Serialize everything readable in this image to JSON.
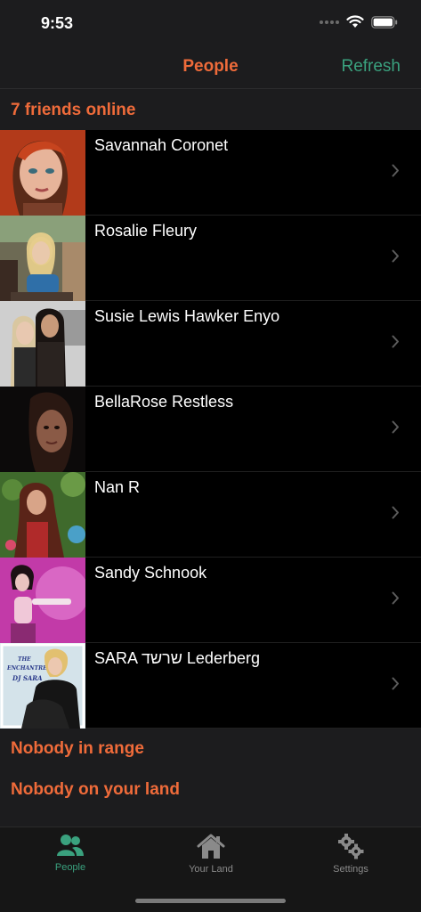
{
  "status": {
    "time": "9:53"
  },
  "nav": {
    "title": "People",
    "refresh_label": "Refresh"
  },
  "sections": {
    "online": "7 friends online",
    "in_range": "Nobody in range",
    "on_land": "Nobody on your land"
  },
  "friends": [
    {
      "name": "Savannah Coronet",
      "avatar": "red-haired-woman-avatar"
    },
    {
      "name": "Rosalie Fleury",
      "avatar": "blonde-woman-seated-avatar"
    },
    {
      "name": "Susie Lewis Hawker Enyo",
      "avatar": "couple-avatar"
    },
    {
      "name": "BellaRose Restless",
      "avatar": "dark-haired-woman-avatar"
    },
    {
      "name": "Nan R",
      "avatar": "woman-in-garden-avatar"
    },
    {
      "name": "Sandy Schnook",
      "avatar": "woman-pink-background-avatar"
    },
    {
      "name": "SARA שרשד Lederberg",
      "avatar": "dj-sara-avatar"
    }
  ],
  "avatar_texts": {
    "dj_line1": "THE",
    "dj_line2": "ENCHANTRESS",
    "dj_line3": "DJ SARA"
  },
  "tabs": [
    {
      "label": "People",
      "icon": "people-icon",
      "active": true
    },
    {
      "label": "Your Land",
      "icon": "house-icon",
      "active": false
    },
    {
      "label": "Settings",
      "icon": "gears-icon",
      "active": false
    }
  ],
  "colors": {
    "accent_orange": "#ef6b3a",
    "accent_green": "#3aa17e",
    "background": "#1c1c1e",
    "list_background": "#000000"
  }
}
